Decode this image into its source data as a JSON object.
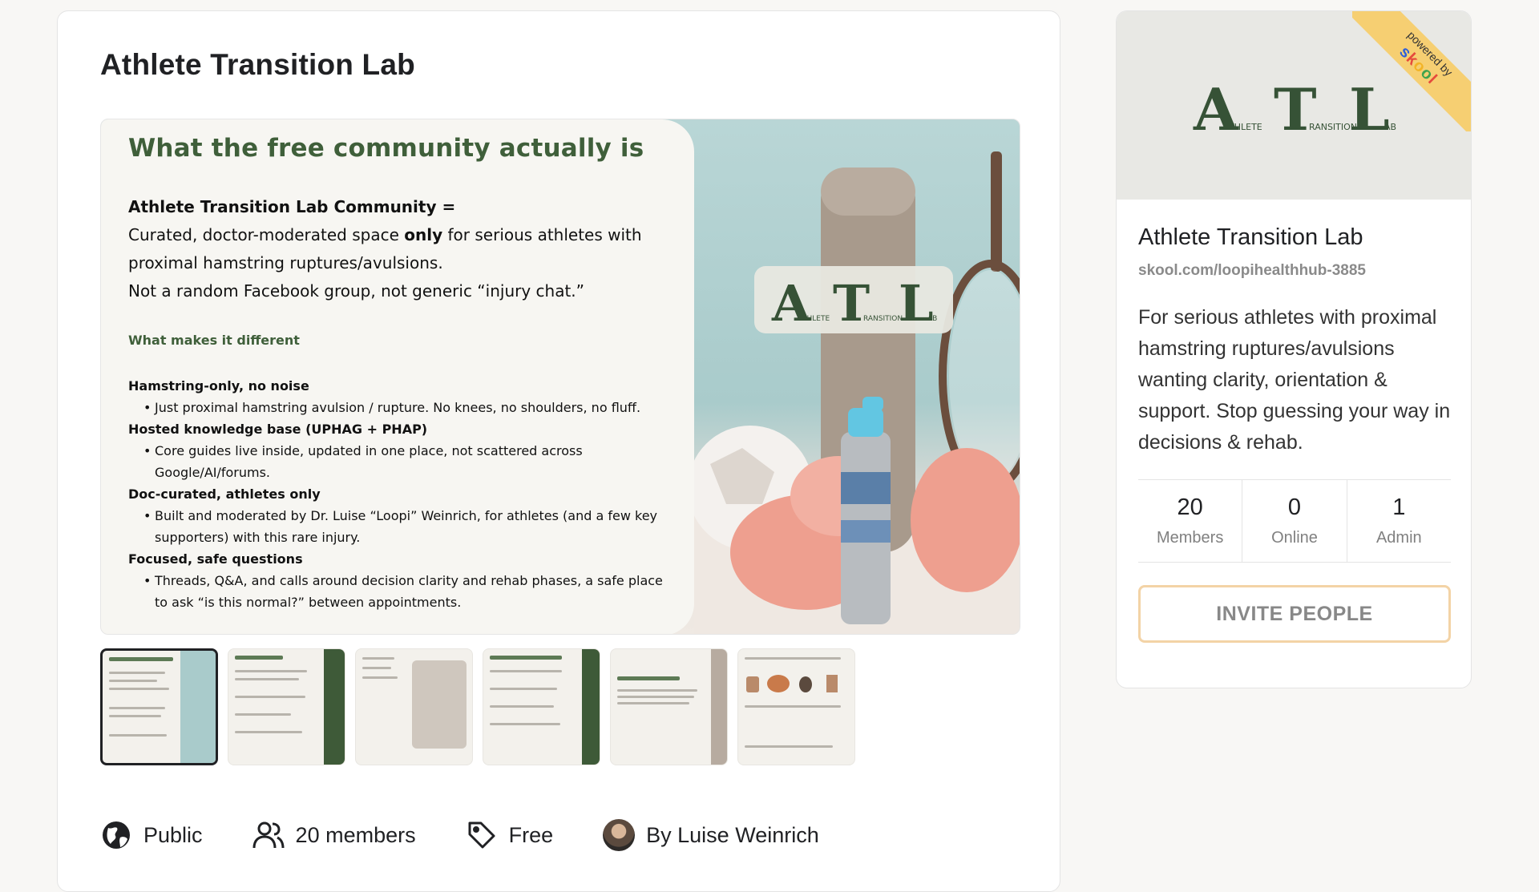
{
  "main": {
    "title": "Athlete Transition Lab",
    "slide": {
      "heading": "What the free community actually is",
      "lead_title": "Athlete Transition Lab Community =",
      "lead_line1_pre": "Curated, doctor-moderated space ",
      "lead_line1_bold": "only",
      "lead_line1_post": " for serious athletes with",
      "lead_line2": "proximal hamstring ruptures/avulsions.",
      "lead_line3": "Not a random Facebook group, not generic “injury chat.”",
      "subheading": "What makes it different",
      "points": [
        {
          "title": "Hamstring-only, no noise",
          "body": "Just proximal hamstring avulsion / rupture. No knees, no shoulders, no fluff."
        },
        {
          "title": "Hosted knowledge base (UPHAG + PHAP)",
          "body": "Core guides live inside, updated in one place, not scattered across Google/AI/forums."
        },
        {
          "title": "Doc-curated, athletes only",
          "body": "Built and moderated by Dr. Luise “Loopi” Weinrich, for athletes (and a few key supporters) with this rare injury."
        },
        {
          "title": "Focused, safe questions",
          "body": "Threads, Q&A, and calls around decision clarity and rehab phases, a safe place to ask “is this normal?” between appointments."
        }
      ],
      "sign_letters": [
        "A",
        "T",
        "L"
      ],
      "sign_words": [
        "THLETE",
        "RANSITION",
        "AB"
      ]
    },
    "thumbnails": [
      {
        "label": "What the free community actually is"
      },
      {
        "label": "What you actually get inside"
      },
      {
        "label": "Meet Dr. Luise Loopi Weinrich"
      },
      {
        "label": "Where the community ends and OYHR begins"
      },
      {
        "label": "Hamstring Recovery"
      },
      {
        "label": "Guided through 6 linked phases over 6 months"
      }
    ],
    "meta": {
      "privacy": "Public",
      "members": "20 members",
      "price": "Free",
      "author": "By Luise Weinrich"
    }
  },
  "sidebar": {
    "ribbon_top": "powered by",
    "ribbon_brand": [
      "s",
      "k",
      "o",
      "o",
      "l"
    ],
    "banner_letters": [
      "A",
      "T",
      "L"
    ],
    "banner_words": [
      "THLETE",
      "RANSITION",
      "AB"
    ],
    "title": "Athlete Transition Lab",
    "url": "skool.com/loopihealthhub-3885",
    "description": "For serious athletes with proximal hamstring ruptures/avulsions wanting clarity, orientation & support. Stop guessing your way in decisions & rehab.",
    "stats": [
      {
        "value": "20",
        "label": "Members"
      },
      {
        "value": "0",
        "label": "Online"
      },
      {
        "value": "1",
        "label": "Admin"
      }
    ],
    "invite_label": "INVITE PEOPLE"
  },
  "colors": {
    "brand_green": "#3f5f3a",
    "ribbon": "#f6cf72",
    "invite_border": "#f3d3a6"
  }
}
